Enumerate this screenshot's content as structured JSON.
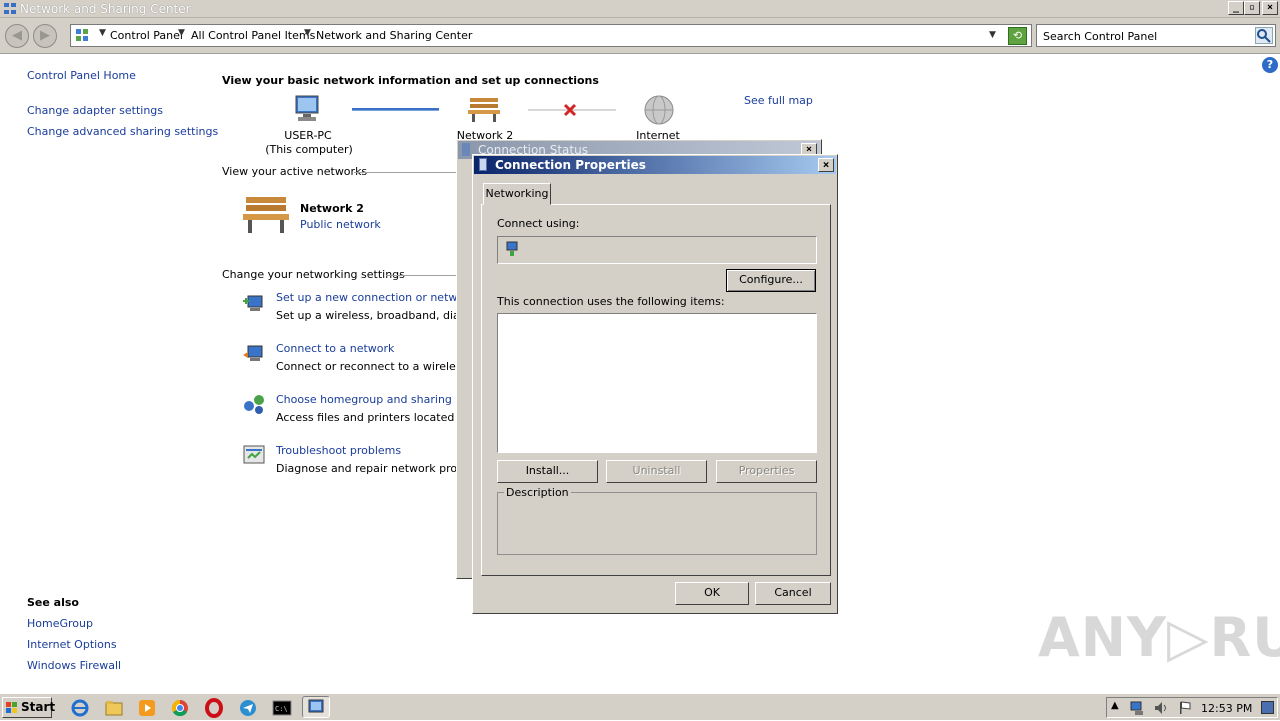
{
  "window": {
    "title": "Network and Sharing Center"
  },
  "address": {
    "crumbs": [
      "Control Panel",
      "All Control Panel Items",
      "Network and Sharing Center"
    ],
    "search_placeholder": "Search Control Panel"
  },
  "sidebar": {
    "home": "Control Panel Home",
    "links": [
      "Change adapter settings",
      "Change advanced sharing settings"
    ],
    "see_also_title": "See also",
    "see_also": [
      "HomeGroup",
      "Internet Options",
      "Windows Firewall"
    ]
  },
  "main": {
    "heading": "View your basic network information and set up connections",
    "see_full_map": "See full map",
    "map": {
      "computer_name": "USER-PC",
      "computer_sub": "(This computer)",
      "network_name": "Network  2",
      "internet": "Internet"
    },
    "active_title": "View your active networks",
    "active_network": {
      "name": "Network  2",
      "type": "Public network"
    },
    "change_title": "Change your networking settings",
    "tasks": [
      {
        "title": "Set up a new connection or network",
        "desc": "Set up a wireless, broadband, dial-up"
      },
      {
        "title": "Connect to a network",
        "desc": "Connect or reconnect to a wireless, w"
      },
      {
        "title": "Choose homegroup and sharing optio",
        "desc": "Access files and printers located on ot"
      },
      {
        "title": "Troubleshoot problems",
        "desc": "Diagnose and repair network problem"
      }
    ]
  },
  "status_dialog": {
    "title": "Connection Status"
  },
  "props_dialog": {
    "title": "Connection Properties",
    "tab": "Networking",
    "connect_using": "Connect using:",
    "configure": "Configure...",
    "items_label": "This connection uses the following items:",
    "install": "Install...",
    "uninstall": "Uninstall",
    "properties": "Properties",
    "description": "Description",
    "ok": "OK",
    "cancel": "Cancel"
  },
  "taskbar": {
    "start": "Start",
    "clock": "12:53 PM"
  },
  "watermark": "ANY RUN"
}
